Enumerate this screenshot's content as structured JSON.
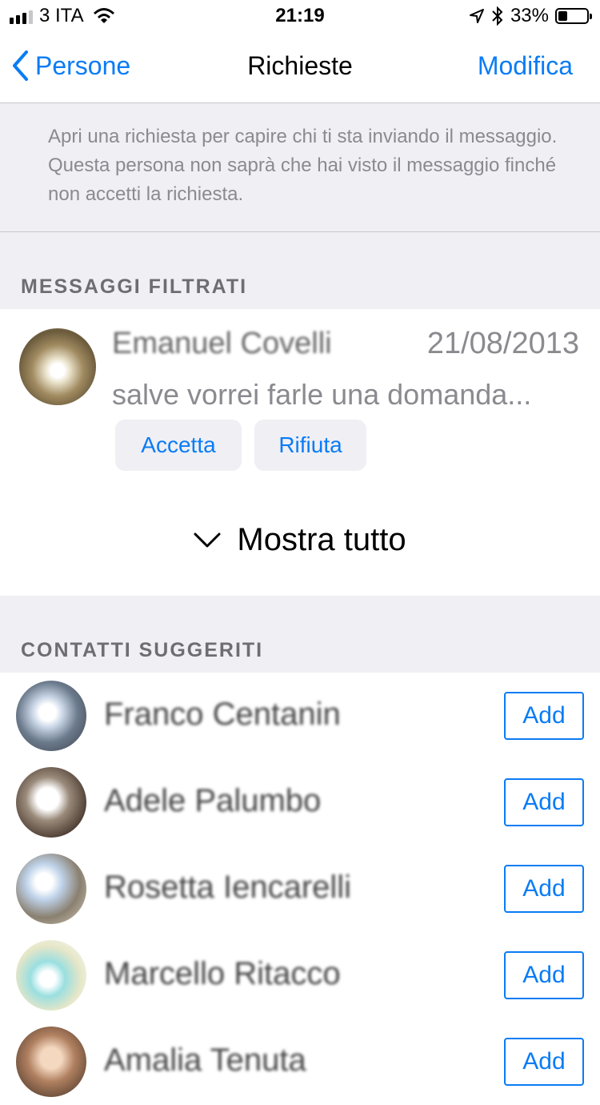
{
  "status_bar": {
    "carrier": "3 ITA",
    "time": "21:19",
    "battery": "33%",
    "battery_level": 0.33
  },
  "nav": {
    "back_label": "Persone",
    "title": "Richieste",
    "edit_label": "Modifica"
  },
  "info_text": "Apri una richiesta per capire chi ti sta inviando il messaggio. Questa persona non saprà che hai visto il messaggio finché non accetti la richiesta.",
  "filtered": {
    "section_title": "MESSAGGI FILTRATI",
    "request": {
      "name": "Emanuel Covelli",
      "date": "21/08/2013",
      "message": "salve vorrei farle una domanda...",
      "accept_label": "Accetta",
      "reject_label": "Rifiuta"
    },
    "show_all_label": "Mostra tutto"
  },
  "suggested": {
    "section_title": "CONTATTI SUGGERITI",
    "contacts": [
      {
        "name": "Franco Centanin",
        "add_label": "Add"
      },
      {
        "name": "Adele Palumbo",
        "add_label": "Add"
      },
      {
        "name": "Rosetta Iencarelli",
        "add_label": "Add"
      },
      {
        "name": "Marcello Ritacco",
        "add_label": "Add"
      },
      {
        "name": "Amalia Tenuta",
        "add_label": "Add"
      }
    ]
  },
  "colors": {
    "accent": "#0a7cf5",
    "group_background": "#efeff4",
    "secondary_text": "#8a8a8f"
  }
}
